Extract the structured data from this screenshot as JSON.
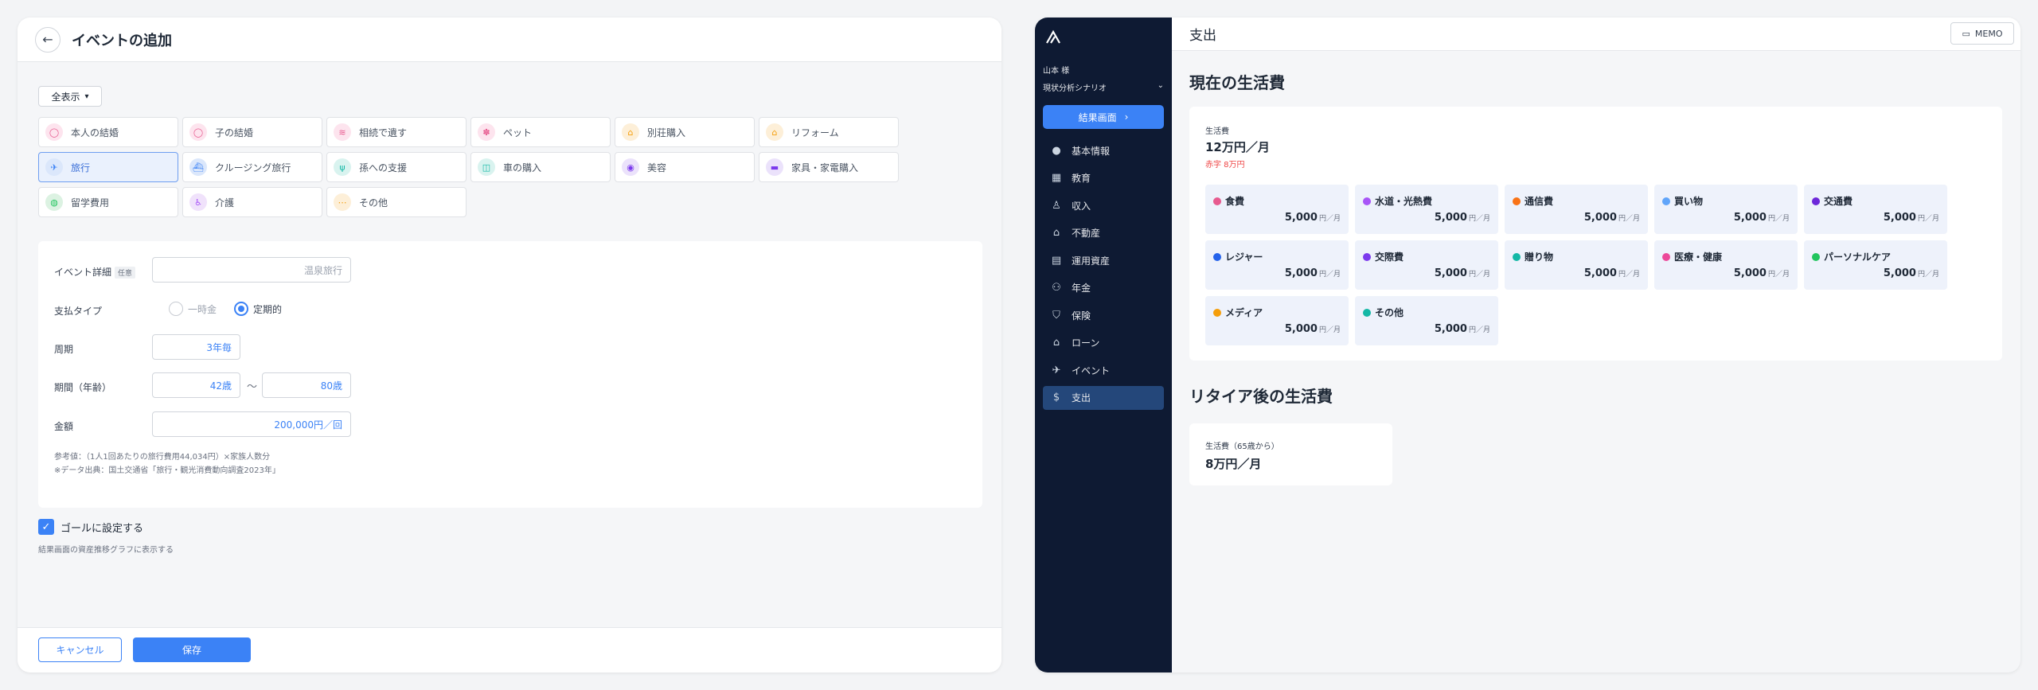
{
  "event_form": {
    "title": "イベントの追加",
    "filter_label": "全表示",
    "categories": [
      {
        "label": "本人の結婚",
        "icon": "ring-icon",
        "color": "#e75a8f",
        "bg": "#fde4ee",
        "glyph": "◯",
        "selected": false
      },
      {
        "label": "子の結婚",
        "icon": "ring-icon",
        "color": "#e75a8f",
        "bg": "#fde4ee",
        "glyph": "◯",
        "selected": false
      },
      {
        "label": "相続で遺す",
        "icon": "money-icon",
        "color": "#e75a8f",
        "bg": "#fde4ee",
        "glyph": "≋",
        "selected": false
      },
      {
        "label": "ペット",
        "icon": "paw-icon",
        "color": "#e75a8f",
        "bg": "#fde4ee",
        "glyph": "✽",
        "selected": false
      },
      {
        "label": "別荘購入",
        "icon": "villa-icon",
        "color": "#f59e0b",
        "bg": "#fdefd8",
        "glyph": "⌂",
        "selected": false
      },
      {
        "label": "リフォーム",
        "icon": "house-repair-icon",
        "color": "#f59e0b",
        "bg": "#fdefd8",
        "glyph": "⌂",
        "selected": false
      },
      {
        "label": "旅行",
        "icon": "airplane-icon",
        "color": "#3b82f6",
        "bg": "#dbe7fb",
        "glyph": "✈",
        "selected": true
      },
      {
        "label": "クルージング旅行",
        "icon": "ship-icon",
        "color": "#3b82f6",
        "bg": "#dbe7fb",
        "glyph": "⛴",
        "selected": false
      },
      {
        "label": "孫への支援",
        "icon": "support-icon",
        "color": "#14b8a6",
        "bg": "#d9f3ef",
        "glyph": "ψ",
        "selected": false
      },
      {
        "label": "車の購入",
        "icon": "car-icon",
        "color": "#14b8a6",
        "bg": "#d9f3ef",
        "glyph": "◫",
        "selected": false
      },
      {
        "label": "美容",
        "icon": "eye-icon",
        "color": "#7c3aed",
        "bg": "#ebe2fb",
        "glyph": "◉",
        "selected": false
      },
      {
        "label": "家具・家電購入",
        "icon": "sofa-icon",
        "color": "#7c3aed",
        "bg": "#ebe2fb",
        "glyph": "▬",
        "selected": false
      },
      {
        "label": "留学費用",
        "icon": "globe-icon",
        "color": "#22c55e",
        "bg": "#dcf2e2",
        "glyph": "◍",
        "selected": false
      },
      {
        "label": "介護",
        "icon": "wheelchair-icon",
        "color": "#a855f7",
        "bg": "#f0e2fb",
        "glyph": "♿",
        "selected": false
      },
      {
        "label": "その他",
        "icon": "dots-icon",
        "color": "#f59e0b",
        "bg": "#fdefd8",
        "glyph": "⋯",
        "selected": false
      }
    ],
    "detail_label": "イベント詳細",
    "detail_tag": "任意",
    "detail_placeholder": "温泉旅行",
    "payment_type_label": "支払タイプ",
    "payment_options": [
      "一時金",
      "定期的"
    ],
    "payment_selected": "定期的",
    "cycle_label": "周期",
    "cycle_value": "3年毎",
    "period_label": "期間（年齢）",
    "period_from": "42歳",
    "period_tilde": "〜",
    "period_to": "80歳",
    "amount_label": "金額",
    "amount_value": "200,000円／回",
    "note_line1": "参考値：（1人1回あたりの旅行費用44,034円）×家族人数分",
    "note_line2": "※データ出典：国土交通省「旅行・観光消費動向調査2023年」",
    "goal_label": "ゴールに設定する",
    "goal_checked": true,
    "goal_sub": "結果画面の資産推移グラフに表示する",
    "cancel_label": "キャンセル",
    "save_label": "保存"
  },
  "expense_app": {
    "user_name": "山本 様",
    "scenario": "現状分析シナリオ",
    "result_button": "結果画面",
    "nav": [
      {
        "label": "基本情報",
        "icon": "person-icon",
        "glyph": "●",
        "active": false
      },
      {
        "label": "教育",
        "icon": "school-icon",
        "glyph": "▦",
        "active": false
      },
      {
        "label": "収入",
        "icon": "income-icon",
        "glyph": "♙",
        "active": false
      },
      {
        "label": "不動産",
        "icon": "home-icon",
        "glyph": "⌂",
        "active": false
      },
      {
        "label": "運用資産",
        "icon": "chart-icon",
        "glyph": "▤",
        "active": false
      },
      {
        "label": "年金",
        "icon": "pension-icon",
        "glyph": "⚇",
        "active": false
      },
      {
        "label": "保険",
        "icon": "shield-icon",
        "glyph": "⛉",
        "active": false
      },
      {
        "label": "ローン",
        "icon": "loan-house-icon",
        "glyph": "⌂",
        "active": false
      },
      {
        "label": "イベント",
        "icon": "airplane-icon",
        "glyph": "✈",
        "active": false
      },
      {
        "label": "支出",
        "icon": "money-bag-icon",
        "glyph": "$",
        "active": true
      }
    ],
    "page_title": "支出",
    "memo_label": "MEMO",
    "current_title": "現在の生活費",
    "cost_label": "生活費",
    "cost_value": "12万円／月",
    "cost_deficit": "赤字 8万円",
    "expenses": [
      {
        "name": "食費",
        "amount": "5,000",
        "unit": "円／月",
        "color": "#e75a8f"
      },
      {
        "name": "水道・光熱費",
        "amount": "5,000",
        "unit": "円／月",
        "color": "#a855f7"
      },
      {
        "name": "通信費",
        "amount": "5,000",
        "unit": "円／月",
        "color": "#f97316"
      },
      {
        "name": "買い物",
        "amount": "5,000",
        "unit": "円／月",
        "color": "#60a5fa"
      },
      {
        "name": "交通費",
        "amount": "5,000",
        "unit": "円／月",
        "color": "#6d28d9"
      },
      {
        "name": "レジャー",
        "amount": "5,000",
        "unit": "円／月",
        "color": "#2563eb"
      },
      {
        "name": "交際費",
        "amount": "5,000",
        "unit": "円／月",
        "color": "#7c3aed"
      },
      {
        "name": "贈り物",
        "amount": "5,000",
        "unit": "円／月",
        "color": "#14b8a6"
      },
      {
        "name": "医療・健康",
        "amount": "5,000",
        "unit": "円／月",
        "color": "#ec4899"
      },
      {
        "name": "パーソナルケア",
        "amount": "5,000",
        "unit": "円／月",
        "color": "#22c55e"
      },
      {
        "name": "メディア",
        "amount": "5,000",
        "unit": "円／月",
        "color": "#f59e0b"
      },
      {
        "name": "その他",
        "amount": "5,000",
        "unit": "円／月",
        "color": "#14b8a6"
      }
    ],
    "retire_title": "リタイア後の生活費",
    "retire_label": "生活費（65歳から）",
    "retire_value": "8万円／月"
  }
}
